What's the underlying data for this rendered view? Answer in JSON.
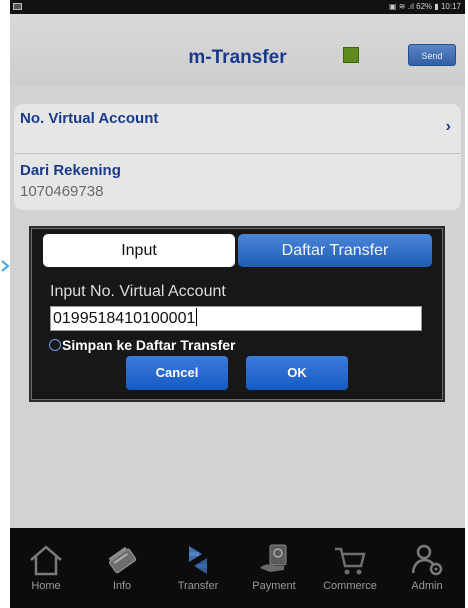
{
  "status_bar": {
    "right_text": "▣ ≋ .ıl 62% ▮ 10:17"
  },
  "header": {
    "title": "m-Transfer",
    "send_label": "Send",
    "indicator_color": "#5f8a1e"
  },
  "form": {
    "virtual_account_label": "No. Virtual Account",
    "chevron_glyph": "›",
    "source_account_label": "Dari Rekening",
    "source_account_value": "1070469738"
  },
  "dialog": {
    "tab_input_label": "Input",
    "tab_list_label": "Daftar Transfer",
    "input_label": "Input No. Virtual Account",
    "input_value": "0199518410100001",
    "save_label": "Simpan ke Daftar Transfer",
    "cancel_label": "Cancel",
    "ok_label": "OK"
  },
  "bottom_nav": {
    "items": [
      {
        "label": "Home",
        "icon": "home-icon"
      },
      {
        "label": "Info",
        "icon": "info-icon"
      },
      {
        "label": "Transfer",
        "icon": "transfer-icon"
      },
      {
        "label": "Payment",
        "icon": "payment-icon"
      },
      {
        "label": "Commerce",
        "icon": "commerce-icon"
      },
      {
        "label": "Admin",
        "icon": "admin-icon"
      }
    ]
  },
  "colors": {
    "accent_blue": "#1a3a8c",
    "button_blue": "#1f5cb7",
    "edge_arrow": "#3aa7e8"
  }
}
